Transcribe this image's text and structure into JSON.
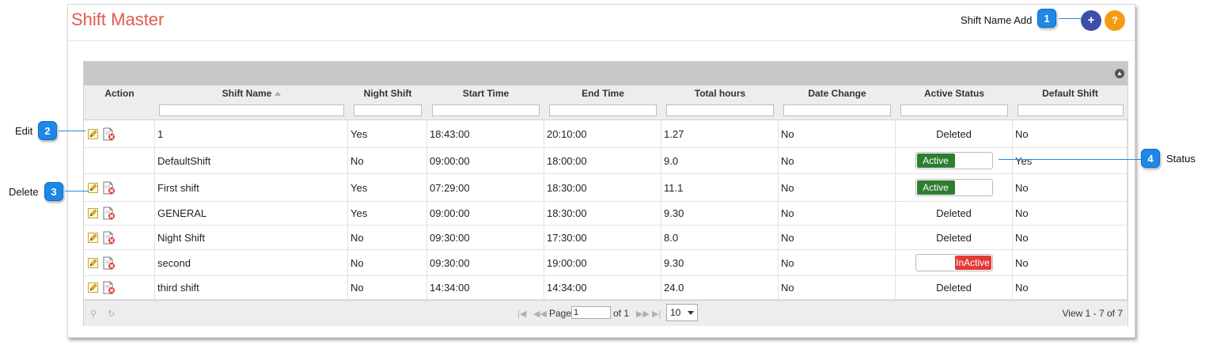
{
  "header": {
    "title": "Shift Master",
    "add_label": "Shift Name Add",
    "add_button": "+",
    "help_button": "?"
  },
  "grid": {
    "columns": [
      "Action",
      "Shift Name",
      "Night Shift",
      "Start Time",
      "End Time",
      "Total hours",
      "Date Change",
      "Active Status",
      "Default Shift"
    ],
    "rows": [
      {
        "name": "1",
        "night": "Yes",
        "start": "18:43:00",
        "end": "20:10:00",
        "hours": "1.27",
        "date_change": "No",
        "status": "Deleted",
        "default": "No",
        "actions": true
      },
      {
        "name": "DefaultShift",
        "night": "No",
        "start": "09:00:00",
        "end": "18:00:00",
        "hours": "9.0",
        "date_change": "No",
        "status": "Active",
        "default": "Yes",
        "actions": false
      },
      {
        "name": "First shift",
        "night": "Yes",
        "start": "07:29:00",
        "end": "18:30:00",
        "hours": "11.1",
        "date_change": "No",
        "status": "Active",
        "default": "No",
        "actions": true
      },
      {
        "name": "GENERAL",
        "night": "Yes",
        "start": "09:00:00",
        "end": "18:30:00",
        "hours": "9.30",
        "date_change": "No",
        "status": "Deleted",
        "default": "No",
        "actions": true
      },
      {
        "name": "Night Shift",
        "night": "No",
        "start": "09:30:00",
        "end": "17:30:00",
        "hours": "8.0",
        "date_change": "No",
        "status": "Deleted",
        "default": "No",
        "actions": true
      },
      {
        "name": "second",
        "night": "No",
        "start": "09:30:00",
        "end": "19:00:00",
        "hours": "9.30",
        "date_change": "No",
        "status": "InActive",
        "default": "No",
        "actions": true
      },
      {
        "name": "third shift",
        "night": "No",
        "start": "14:34:00",
        "end": "14:34:00",
        "hours": "24.0",
        "date_change": "No",
        "status": "Deleted",
        "default": "No",
        "actions": true
      }
    ]
  },
  "pager": {
    "page_label": "Page",
    "page_value": "1",
    "of_label": "of 1",
    "per_page": "10",
    "view_text": "View 1 - 7 of 7"
  },
  "callouts": [
    {
      "number": "1"
    },
    {
      "number": "2",
      "label": "Edit"
    },
    {
      "number": "3",
      "label": "Delete"
    },
    {
      "number": "4",
      "label": "Status"
    }
  ],
  "colors": {
    "title": "#e05a4f",
    "add_button": "#3d4eaa",
    "help_button": "#f39c12",
    "active": "#2e7d32",
    "inactive": "#e53935",
    "callout": "#1e88e5"
  },
  "icons": {
    "edit": "pencil-icon",
    "delete": "delete-document-icon",
    "search": "search-icon",
    "refresh": "refresh-icon",
    "collapse": "collapse-icon"
  }
}
